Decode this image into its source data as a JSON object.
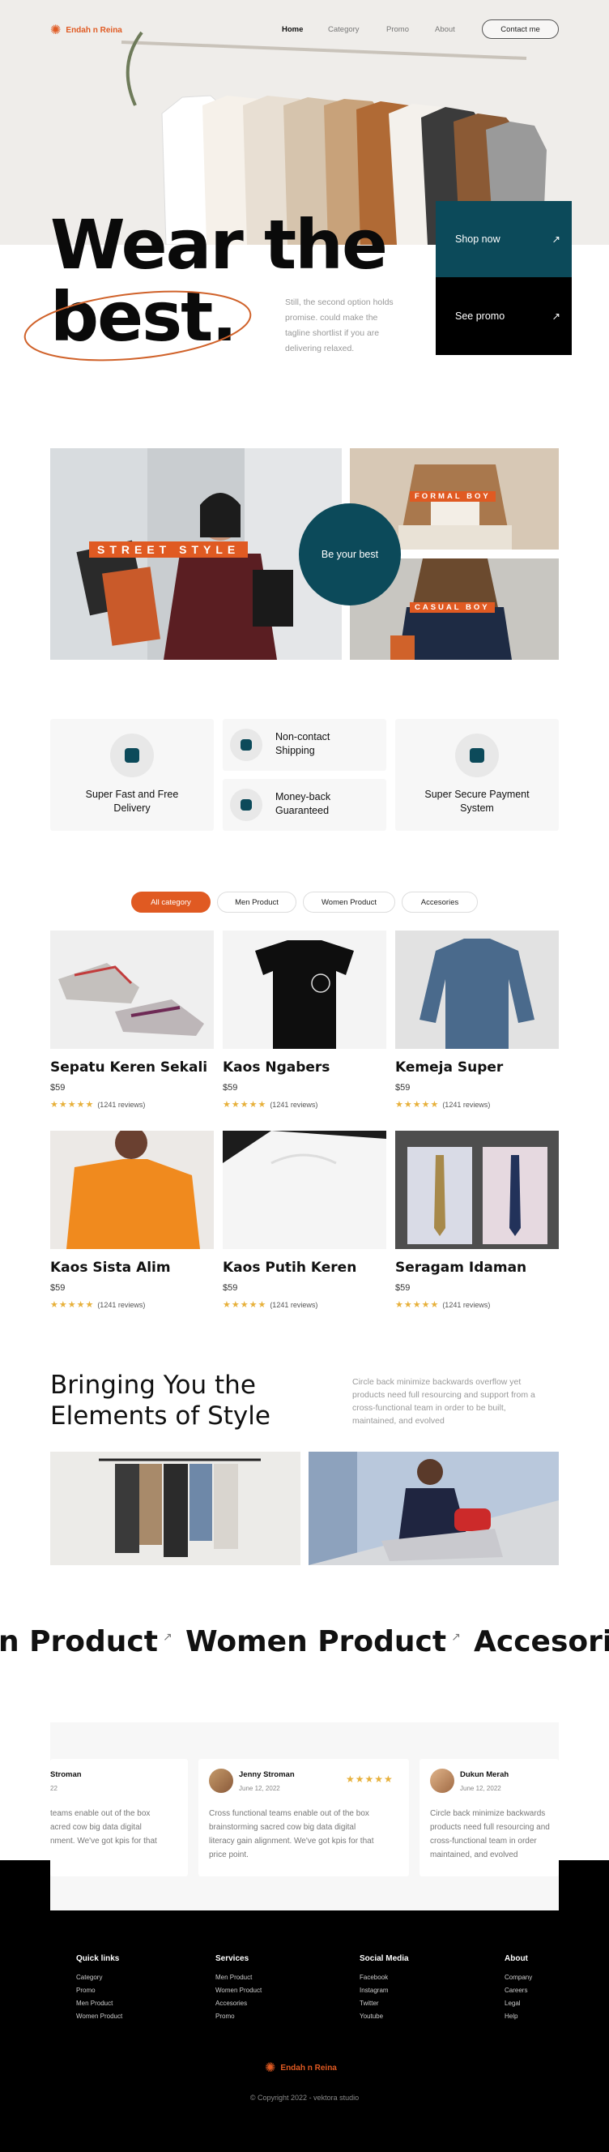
{
  "brand": {
    "name": "Endah n Reina",
    "accent": "#e05a22",
    "teal": "#0c4a5a"
  },
  "nav": {
    "items": [
      "Home",
      "Category",
      "Promo",
      "About"
    ],
    "contact": "Contact me"
  },
  "hero": {
    "title_line1": "Wear the",
    "title_line2": "best.",
    "tagline": [
      "Still, the second option holds",
      "promise. could make the",
      "tagline shortlist if you are",
      "delivering relaxed."
    ],
    "shop_now": "Shop now",
    "see_promo": "See promo"
  },
  "showcase": {
    "street": "STREET STYLE",
    "formal": "FORMAL BOY",
    "casual": "CASUAL BOY",
    "badge": "Be your best"
  },
  "features": [
    {
      "title": [
        "Super Fast and Free",
        "Delivery"
      ],
      "icon": "delivery-truck-icon"
    },
    {
      "title": [
        "Non-contact",
        "Shipping"
      ],
      "icon": "shield-check-icon"
    },
    {
      "title": [
        "Money-back",
        "Guaranteed"
      ],
      "icon": "money-icon"
    },
    {
      "title": [
        "Super Secure Payment",
        "System"
      ],
      "icon": "secure-card-icon"
    }
  ],
  "filters": [
    "All category",
    "Men Product",
    "Women Product",
    "Accesories"
  ],
  "products": [
    {
      "name": "Sepatu Keren Sekali",
      "price": "$59",
      "reviews": "(1241 reviews)",
      "rating": 5
    },
    {
      "name": "Kaos Ngabers",
      "price": "$59",
      "reviews": "(1241 reviews)",
      "rating": 5
    },
    {
      "name": "Kemeja Super",
      "price": "$59",
      "reviews": "(1241 reviews)",
      "rating": 5
    },
    {
      "name": "Kaos Sista Alim",
      "price": "$59",
      "reviews": "(1241 reviews)",
      "rating": 5
    },
    {
      "name": "Kaos Putih Keren",
      "price": "$59",
      "reviews": "(1241 reviews)",
      "rating": 5
    },
    {
      "name": "Seragam Idaman",
      "price": "$59",
      "reviews": "(1241 reviews)",
      "rating": 5
    }
  ],
  "style_section": {
    "heading_line1": "Bringing You the",
    "heading_line2": "Elements of Style",
    "desc": [
      "Circle back minimize backwards overflow yet",
      "products need full resourcing and support from a",
      "cross-functional team in order to be built,",
      "maintained, and evolved"
    ]
  },
  "marquee": [
    "n Product",
    "Women Product",
    "Accesorie"
  ],
  "testimonials": [
    {
      "name": "Stroman",
      "date": "22",
      "text": [
        "teams enable out of the box",
        "acred cow big data digital",
        "nment. We've got kpis for that"
      ]
    },
    {
      "name": "Jenny Stroman",
      "date": "June 12, 2022",
      "stars": "★★★★★",
      "text": [
        "Cross functional teams enable out of the box",
        "brainstorming sacred cow big data digital",
        "literacy gain alignment. We've got kpis for that",
        "price point."
      ]
    },
    {
      "name": "Dukun Merah",
      "date": "June 12, 2022",
      "text": [
        "Circle back minimize backwards",
        "products need full resourcing and",
        "cross-functional team in order",
        "maintained, and evolved"
      ]
    }
  ],
  "footer": {
    "columns": [
      {
        "title": "Quick links",
        "links": [
          "Category",
          "Promo",
          "Men Product",
          "Women Product"
        ]
      },
      {
        "title": "Services",
        "links": [
          "Men Product",
          "Women Product",
          "Accesories",
          "Promo"
        ]
      },
      {
        "title": "Social Media",
        "links": [
          "Facebook",
          "Instagram",
          "Twitter",
          "Youtube"
        ]
      },
      {
        "title": "About",
        "links": [
          "Company",
          "Careers",
          "Legal",
          "Help"
        ]
      }
    ],
    "copyright": "© Copyright 2022 - vektora studio"
  }
}
